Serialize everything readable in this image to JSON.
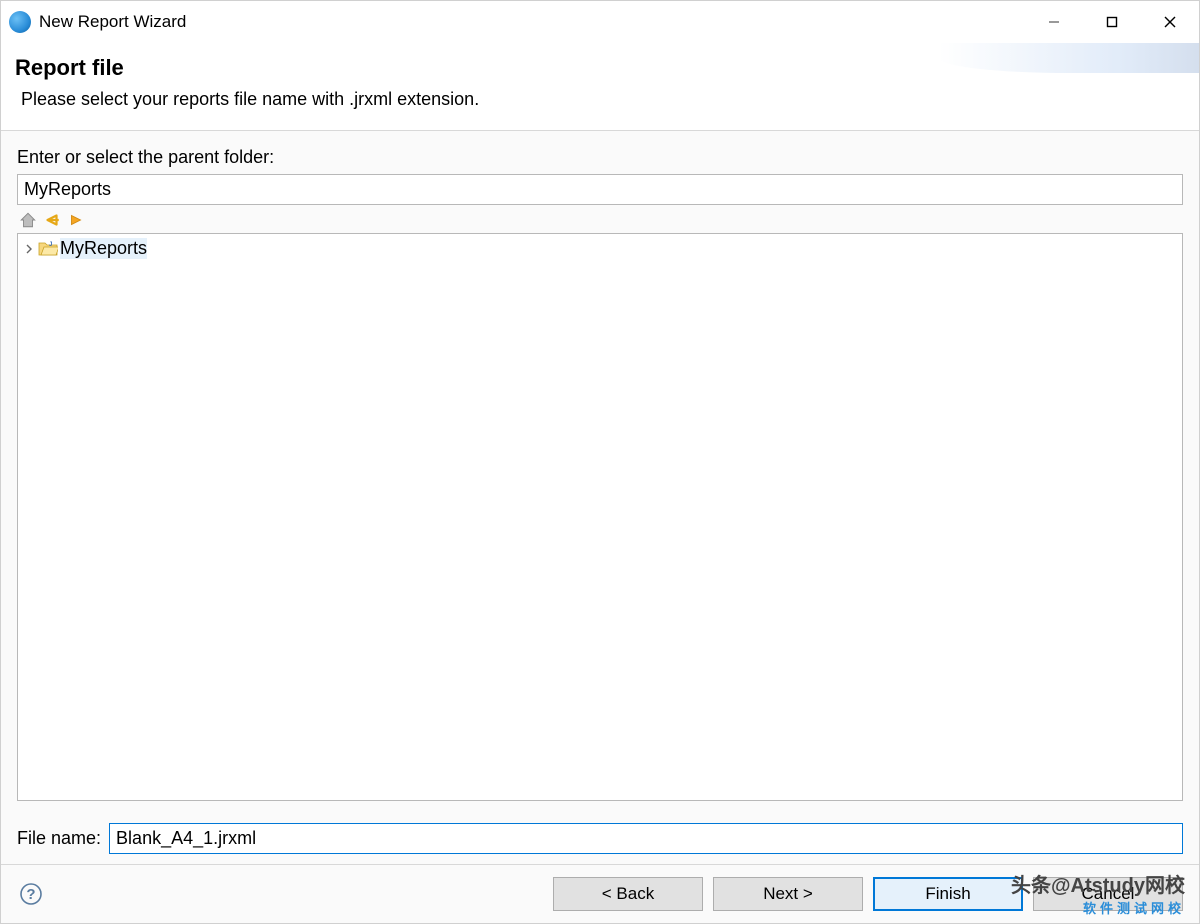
{
  "window": {
    "title": "New Report Wizard"
  },
  "banner": {
    "title": "Report file",
    "subtitle": "Please select your reports file name with .jrxml extension."
  },
  "content": {
    "parent_folder_label": "Enter or select the parent folder:",
    "parent_folder_value": "MyReports",
    "tree": {
      "items": [
        {
          "label": "MyReports",
          "expanded": false,
          "selected": true
        }
      ]
    },
    "file_name_label": "File name:",
    "file_name_value": "Blank_A4_1.jrxml"
  },
  "buttons": {
    "back": "< Back",
    "next": "Next >",
    "finish": "Finish",
    "cancel": "Cancel"
  },
  "watermark": {
    "main": "头条@Atstudy网校",
    "sub": "软件测试网校"
  }
}
